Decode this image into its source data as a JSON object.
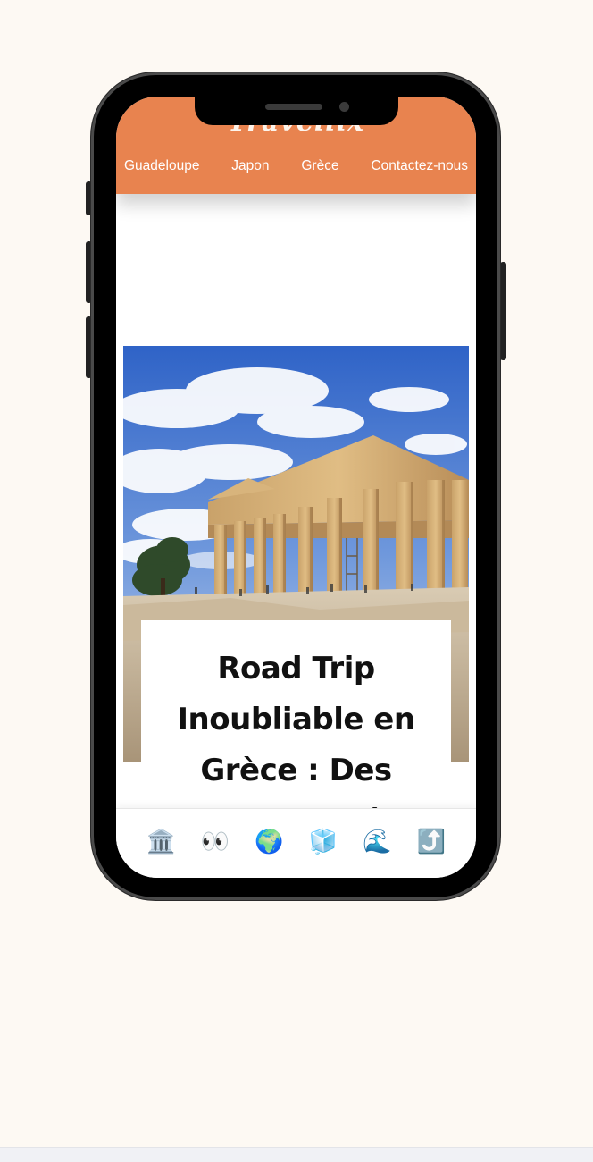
{
  "header": {
    "logo": "Travellix",
    "nav": [
      "Guadeloupe",
      "Japon",
      "Grèce",
      "Contactez-nous"
    ]
  },
  "article": {
    "title": "Road Trip Inoubliable en Grèce : Des Plages de Rêve"
  },
  "bottom_bar": {
    "icons": [
      {
        "name": "classical-building-icon",
        "glyph": "🏛️"
      },
      {
        "name": "eyes-icon",
        "glyph": "👀"
      },
      {
        "name": "globe-icon",
        "glyph": "🌍"
      },
      {
        "name": "ice-cube-icon",
        "glyph": "🧊"
      },
      {
        "name": "wave-icon",
        "glyph": "🌊"
      },
      {
        "name": "arrow-up-right-icon",
        "glyph": "⤴️"
      }
    ]
  },
  "colors": {
    "page_background": "#fdf9f3",
    "header": "#e8834f",
    "nav_text": "#ffffff",
    "title_text": "#111111"
  }
}
